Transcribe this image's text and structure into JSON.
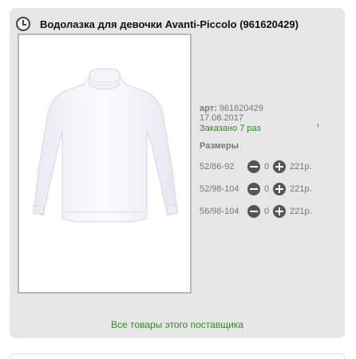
{
  "product": {
    "icon": "clock-icon",
    "title": "Водолазка для девочки Avanti-Piccolo (961620429)",
    "image": "white-turtleneck-photo",
    "article_label": "арт:",
    "article_value": "961620429",
    "date": "17.08.2017",
    "ordered_text": "Заказано 7 раз"
  },
  "sizes": {
    "header": "Размеры",
    "items": [
      {
        "label": "52/86-92",
        "qty": "0",
        "price": "221р."
      },
      {
        "label": "52/98-104",
        "qty": "0",
        "price": "221р."
      },
      {
        "label": "56/98-104",
        "qty": "0",
        "price": "221р."
      }
    ]
  },
  "footer": {
    "supplier_link": "Все товары этого поставщика"
  },
  "colors": {
    "accent_green": "#2e8b1e",
    "card_bg": "#e6e6e6",
    "button_dark": "#555555"
  }
}
